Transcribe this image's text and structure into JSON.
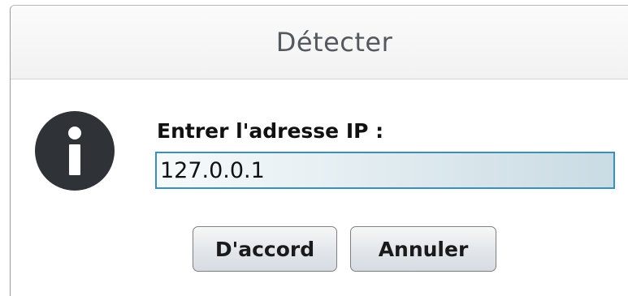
{
  "dialog": {
    "title": "Détecter",
    "prompt": "Entrer l'adresse IP :",
    "ip_value": "127.0.0.1",
    "icon": "info-icon",
    "buttons": {
      "ok_label": "D'accord",
      "cancel_label": "Annuler"
    }
  },
  "colors": {
    "input_border": "#3c8fb6",
    "icon_fill": "#2f3236",
    "title_text": "#53595f"
  }
}
